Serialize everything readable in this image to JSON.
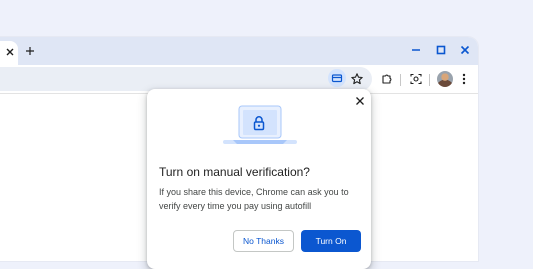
{
  "browser": {
    "tab_close_icon": "close-icon",
    "new_tab_icon": "plus-icon",
    "window_controls": [
      "minimize-icon",
      "maximize-icon",
      "close-icon"
    ],
    "toolbar_icons": [
      "card-icon",
      "star-icon",
      "extensions-icon",
      "screenshot-icon",
      "avatar",
      "more-vert-icon"
    ]
  },
  "dialog": {
    "title": "Turn on manual verification?",
    "body": "If you share this device, Chrome can ask you to verify every time you pay using autofill",
    "secondary_button": "No Thanks",
    "primary_button": "Turn On",
    "illustration_icon": "lock-icon"
  },
  "colors": {
    "accent": "#0b57d0",
    "frame": "#dfe6f5",
    "background": "#eef1fb"
  }
}
